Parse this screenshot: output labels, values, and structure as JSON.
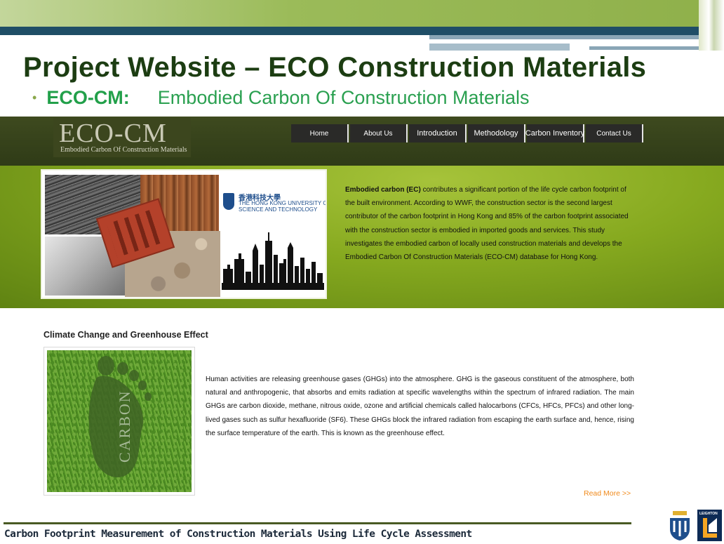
{
  "slide": {
    "title": "Project Website – ECO Construction Materials",
    "subtitle_bullet": "•",
    "subtitle_acronym": "ECO-CM:",
    "subtitle_text": "Embodied Carbon Of Construction Materials",
    "footer": "Carbon Footprint Measurement of Construction Materials Using Life Cycle Assessment",
    "leighton_label": "LEIGHTON"
  },
  "site": {
    "logo_main": "ECO-CM",
    "logo_sub": "Embodied Carbon Of Construction Materials",
    "nav": [
      "Home",
      "About Us",
      "Introduction",
      "Methodology",
      "Carbon Inventory",
      "Contact Us"
    ],
    "hkust_cn": "香港科技大學",
    "hkust_en1": "THE HONG KONG UNIVERSITY OF",
    "hkust_en2": "SCIENCE AND TECHNOLOGY",
    "intro_bold": "Embodied carbon (EC)",
    "intro_rest": " contributes a significant portion of the life cycle carbon footprint of the built environment. According to WWF, the construction sector is the second largest contributor of the carbon footprint in Hong Kong and 85% of the carbon footprint associated with the construction sector is embodied in imported goods and services. This study investigates the embodied carbon of locally used construction materials and develops the Embodied Carbon Of Construction Materials (ECO-CM) database for Hong Kong.",
    "section_title": "Climate Change and Greenhouse Effect",
    "carbon_label": "CARBON",
    "section_body": "Human activities are releasing greenhouse gases (GHGs) into the atmosphere. GHG is the gaseous constituent of the atmosphere, both natural and anthropogenic, that absorbs and emits radiation at specific wavelengths within the spectrum of infrared radiation. The main GHGs are carbon dioxide, methane, nitrous oxide, ozone and artificial chemicals called halocarbons (CFCs, HFCs, PFCs) and other long-lived gases such as sulfur hexafluoride (SF6). These GHGs block the infrared radiation from escaping the earth surface and, hence, rising the surface temperature of the earth. This is known as the greenhouse effect.",
    "read_more": "Read More >>"
  },
  "colors": {
    "title_green": "#1c3d12",
    "subtitle_green": "#2aa050",
    "banner_green": "#86a91f",
    "header_dark": "#2f3b17",
    "read_more_orange": "#f08a1c"
  }
}
